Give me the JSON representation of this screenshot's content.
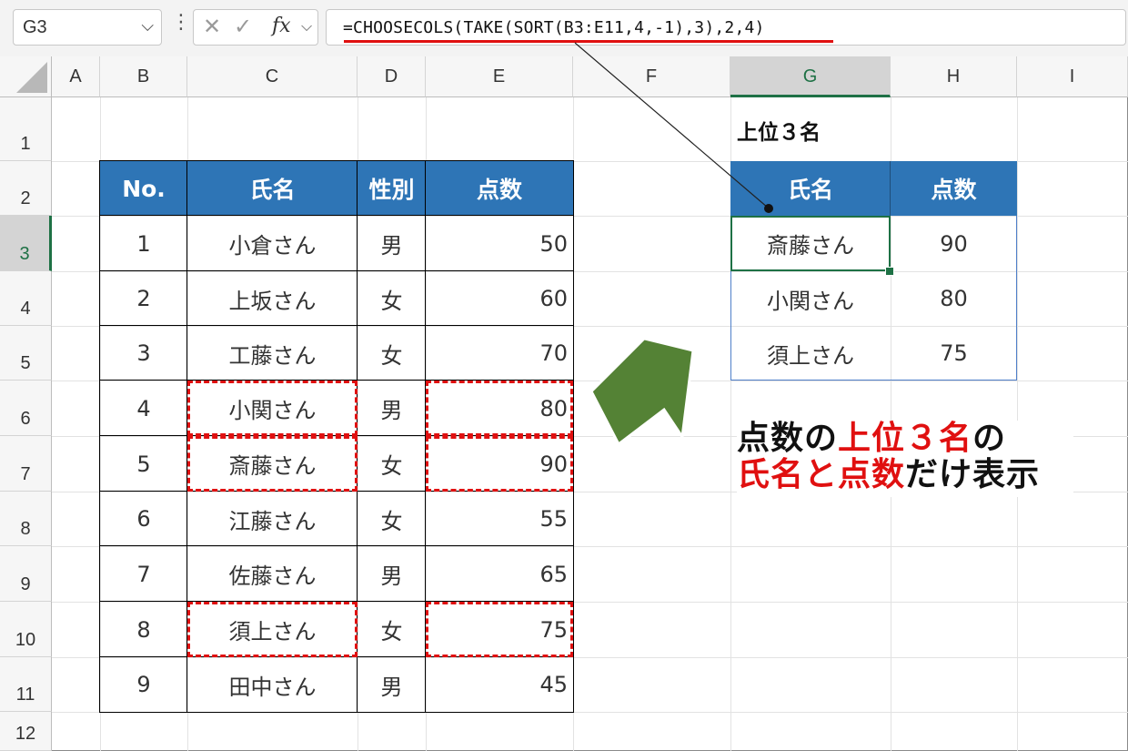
{
  "name_box": "G3",
  "formula": "=CHOOSECOLS(TAKE(SORT(B3:E11,4,-1),3),2,4)",
  "icons": {
    "cancel": "✕",
    "enter": "✓",
    "function": "fx",
    "dropdown": "⌵",
    "more": "⋮"
  },
  "columns": [
    "A",
    "B",
    "C",
    "D",
    "E",
    "F",
    "G",
    "H",
    "I"
  ],
  "rows": [
    "1",
    "2",
    "3",
    "4",
    "5",
    "6",
    "7",
    "8",
    "9",
    "10",
    "11",
    "12"
  ],
  "source_table": {
    "headers": [
      "No.",
      "氏名",
      "性別",
      "点数"
    ],
    "rows": [
      [
        "1",
        "小倉さん",
        "男",
        "50"
      ],
      [
        "2",
        "上坂さん",
        "女",
        "60"
      ],
      [
        "3",
        "工藤さん",
        "女",
        "70"
      ],
      [
        "4",
        "小関さん",
        "男",
        "80"
      ],
      [
        "5",
        "斎藤さん",
        "女",
        "90"
      ],
      [
        "6",
        "江藤さん",
        "女",
        "55"
      ],
      [
        "7",
        "佐藤さん",
        "男",
        "65"
      ],
      [
        "8",
        "須上さん",
        "女",
        "75"
      ],
      [
        "9",
        "田中さん",
        "男",
        "45"
      ]
    ]
  },
  "result_title": "上位３名",
  "result_table": {
    "headers": [
      "氏名",
      "点数"
    ],
    "rows": [
      [
        "斎藤さん",
        "90"
      ],
      [
        "小関さん",
        "80"
      ],
      [
        "須上さん",
        "75"
      ]
    ]
  },
  "callout": {
    "line1": [
      "点数の",
      "上位３名",
      "の"
    ],
    "line2": [
      "氏名と点数",
      "だけ表示"
    ]
  },
  "colors": {
    "header_blue": "#2e75b6",
    "highlight_red": "#e01010",
    "arrow_green": "#548235",
    "selection_green": "#1e7145"
  }
}
